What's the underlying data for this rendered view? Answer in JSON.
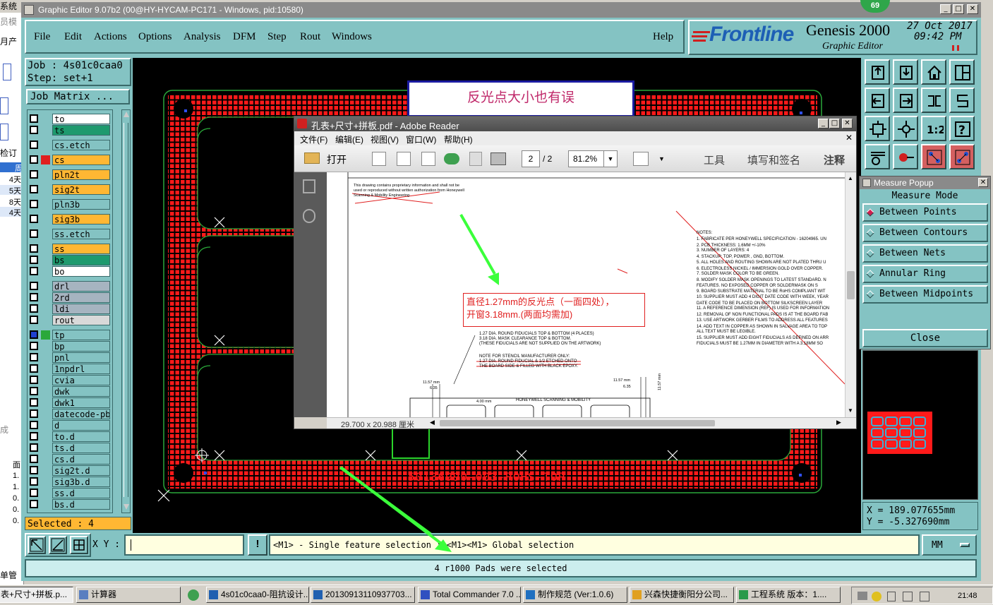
{
  "window": {
    "title": "Graphic Editor 9.07b2 (00@HY-HYCAM-PC171 - Windows, pid:10580)",
    "badge": "69"
  },
  "menu": {
    "items": [
      "File",
      "Edit",
      "Actions",
      "Options",
      "Analysis",
      "DFM",
      "Step",
      "Rout",
      "Windows"
    ],
    "help": "Help"
  },
  "brand": {
    "logo": "Frontline",
    "product": "Genesis 2000",
    "subtitle": "Graphic Editor",
    "date": "27 Oct 2017",
    "time": "09:42 PM"
  },
  "job": {
    "job_label": "Job : 4s01c0caa0",
    "step_label": "Step: set+1",
    "matrix_button": "Job Matrix ..."
  },
  "layers": [
    {
      "name": "to",
      "color": "#ffffff"
    },
    {
      "name": "ts",
      "color": "#1e9a6e"
    },
    {
      "name": "cs.etch",
      "color": "#84c3c3"
    },
    {
      "name": "cs",
      "color": "#ffb733",
      "checked": true
    },
    {
      "name": "pln2t",
      "color": "#ffb733"
    },
    {
      "name": "sig2t",
      "color": "#ffb733"
    },
    {
      "name": "pln3b",
      "color": "#84c3c3"
    },
    {
      "name": "sig3b",
      "color": "#ffb733"
    },
    {
      "name": "ss.etch",
      "color": "#84c3c3"
    },
    {
      "name": "ss",
      "color": "#ffb733"
    },
    {
      "name": "bs",
      "color": "#1e9a6e"
    },
    {
      "name": "bo",
      "color": "#ffffff"
    },
    {
      "name": "drl",
      "color": "#a6b4c0"
    },
    {
      "name": "2rd",
      "color": "#a6b4c0"
    },
    {
      "name": "ldi",
      "color": "#a6b4c0"
    },
    {
      "name": "rout",
      "color": "#d9d9d9"
    },
    {
      "name": "tp",
      "color": "#84c3c3"
    },
    {
      "name": "bp",
      "color": "#84c3c3"
    },
    {
      "name": "pnl",
      "color": "#84c3c3"
    },
    {
      "name": "1npdrl",
      "color": "#84c3c3"
    },
    {
      "name": "cvia",
      "color": "#84c3c3"
    },
    {
      "name": "dwk",
      "color": "#84c3c3"
    },
    {
      "name": "dwk1",
      "color": "#84c3c3"
    },
    {
      "name": "datecode-pbc",
      "color": "#84c3c3"
    },
    {
      "name": "d",
      "color": "#84c3c3"
    },
    {
      "name": "to.d",
      "color": "#84c3c3"
    },
    {
      "name": "ts.d",
      "color": "#84c3c3"
    },
    {
      "name": "cs.d",
      "color": "#84c3c3"
    },
    {
      "name": "sig2t.d",
      "color": "#84c3c3"
    },
    {
      "name": "sig3b.d",
      "color": "#84c3c3"
    },
    {
      "name": "ss.d",
      "color": "#84c3c3"
    },
    {
      "name": "bs.d",
      "color": "#84c3c3"
    }
  ],
  "selected": "Selected : 4",
  "canvas": {
    "board_text": "50136990-003-ROHS-TOP",
    "annotation": "反光点大小也有误"
  },
  "measure": {
    "title": "Measure Popup",
    "mode": "Measure Mode",
    "options": [
      "Between Points",
      "Between Contours",
      "Between Nets",
      "Annular Ring",
      "Between Midpoints"
    ],
    "close": "Close"
  },
  "coords": {
    "x": "X =  189.077655mm",
    "y": "Y =  -5.327690mm"
  },
  "bottom": {
    "xy_label": "X Y :",
    "hint": "<M1> - Single feature selection ; <M1><M1> Global selection",
    "units": "MM",
    "status": "4 r1000 Pads were selected"
  },
  "adobe": {
    "title": "孔表+尺寸+拼板.pdf - Adobe Reader",
    "menu": [
      "文件(F)",
      "编辑(E)",
      "视图(V)",
      "窗口(W)",
      "帮助(H)"
    ],
    "open": "打开",
    "page": "2",
    "page_total": "/ 2",
    "zoom": "81.2%",
    "tools": [
      "工具",
      "填写和签名",
      "注释"
    ],
    "size": "29.700 x 20.988 厘米",
    "red_note_line1": "直径1.27mm的反光点（一面四处），",
    "red_note_line2": "开窗3.18mm.(两面均需加)",
    "doc_top_note": "This drawing contains proprietary information and shall not be used or reproduced without written authorization from Honeywell Scanning & Mobility Engineering",
    "notes_title": "NOTES:",
    "notes": [
      "1. FABRICATE PER HONEYWELL SPECIFICATION - 16204965. UN",
      "2. PCB THICKNESS:  1.6MM +/-10%",
      "3. NUMBER OF LAYERS: 4",
      "4. STACKUP:  TOP, POWER , GND, BOTTOM.",
      "5. ALL HOLES AND ROUTING SHOWN ARE NOT PLATED THRU U",
      "6. ELECTROLESS NICKEL / IMMERSION GOLD OVER COPPER.",
      "7. SOLDER MASK COLOR TO BE GREEN.",
      "8. MODIFY SOLDER MASK OPENINGS TO LATEST STANDARD. N",
      "   FEATURES.  NO EXPOSED COPPER OR SOLDERMASK ON S",
      "9. BOARD SUBSTRATE MATERIAL TO BE RoHS COMPLIANT WIT",
      "10. SUPPLIER MUST ADD 4 DIGIT DATE CODE WITH WEEK, YEAR",
      "    DATE CODE TO BE PLACED ON BOTTOM SILKSCREEN LAYER",
      "11. A REFERENCE DIMENSION (REF) IS USED FOR INFORMATION",
      "12. REMOVAL OF NON FUNCTIONAL PADS IS AT THE BOARD FAB",
      "13. USE ARTWORK GERBER FILMS TO ADDRESS ALL FEATURES",
      "14. ADD TEXT IN COPPER AS SHOWN IN SALVAGE AREA TO TOP",
      "    ALL TEXT MUST BE LEGIBLE.",
      "15. SUPPLIER MUST ADD EIGHT FIDUCIALS AS DEFINED ON ARR",
      "    FIDUCIALS MUST BE 1.27MM IN DIAMETER WITH A 3.18MM SO"
    ],
    "fid_note": [
      "1.27 DIA. ROUND FIDUCIALS TOP & BOTTOM (4 PLACES)",
      "3.18 DIA. MASK CLEARANCE TOP & BOTTOM.",
      "(THESE FIDUCIALS ARE NOT SUPPLIED ON THE ARTWORK)"
    ],
    "stencil_note": [
      "NOTE FOR STENCIL MANUFACTURER ONLY:",
      "1.27 DIA. ROUND FIDUCIAL & 1/2 ETCHED ONTO",
      "THE BOARD SIDE & FILLED WITH BLACK EPOXY."
    ],
    "drawing_label": "HONEYWELL SCANNING & MOBILITY",
    "dims": [
      "11.57 mm",
      "6.35",
      "4.00 mm",
      "11.57 mm",
      "6.35",
      "11.57 mm"
    ]
  },
  "left_app": {
    "items": [
      "系统",
      "员模",
      "月产量",
      "检订单",
      "周",
      "4天",
      "5天",
      "8天",
      "4天",
      "成",
      "面",
      "1.",
      "1.",
      "0.",
      "0.",
      "0.",
      "0.",
      "单管理"
    ]
  },
  "taskbar": {
    "items": [
      "表+尺寸+拼板.p...",
      "计算器",
      "4s01c0caa0-阻抗设计...",
      "20130913110937703...",
      "Total Commander 7.0 ...",
      "制作规范 (Ver:1.0.6)",
      "兴森快捷衡阳分公司...",
      "工程系统  版本：1...."
    ],
    "clock": "21:48"
  }
}
